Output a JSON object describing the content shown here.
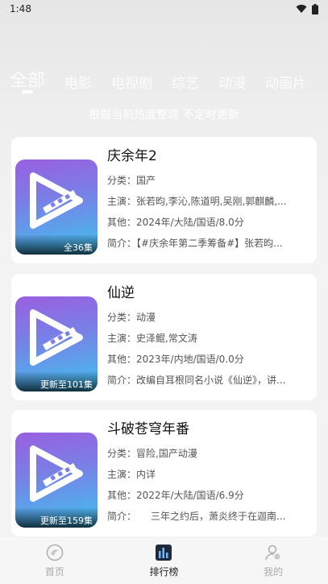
{
  "status": {
    "time": "1:48"
  },
  "tabs": [
    "全部",
    "电影",
    "电视剧",
    "综艺",
    "动漫",
    "动画片"
  ],
  "subtitle": "根据当前热度整理 不定时更新",
  "labels": {
    "category": "分类：",
    "cast": "主演：",
    "other": "其他：",
    "intro": "简介："
  },
  "items": [
    {
      "title": "庆余年2",
      "badge": "全36集",
      "category": "国产",
      "cast": "张若昀,李沁,陈道明,吴刚,郭麒麟,...",
      "other": "2024年/大陆/国语/8.0分",
      "intro": "【#庆余年第二季筹备#】张若昀..."
    },
    {
      "title": "仙逆",
      "badge": "更新至101集",
      "category": "动漫",
      "cast": "史泽鲲,常文涛",
      "other": "2023年/内地/国语/0.0分",
      "intro": "改编自耳根同名小说《仙逆》，讲..."
    },
    {
      "title": "斗破苍穹年番",
      "badge": "更新至159集",
      "category": "冒险,国产动漫",
      "cast": "内详",
      "other": "2022年/大陆/国语/6.9分",
      "intro": "　　三年之约后，萧炎终于在迦南..."
    }
  ],
  "nav": {
    "home": "首页",
    "rank": "排行榜",
    "mine": "我的"
  },
  "colors": {
    "accent_gradient_top": "#9a5fe0",
    "accent_gradient_bottom": "#3ec3ee",
    "card_bg": "#ffffff"
  }
}
